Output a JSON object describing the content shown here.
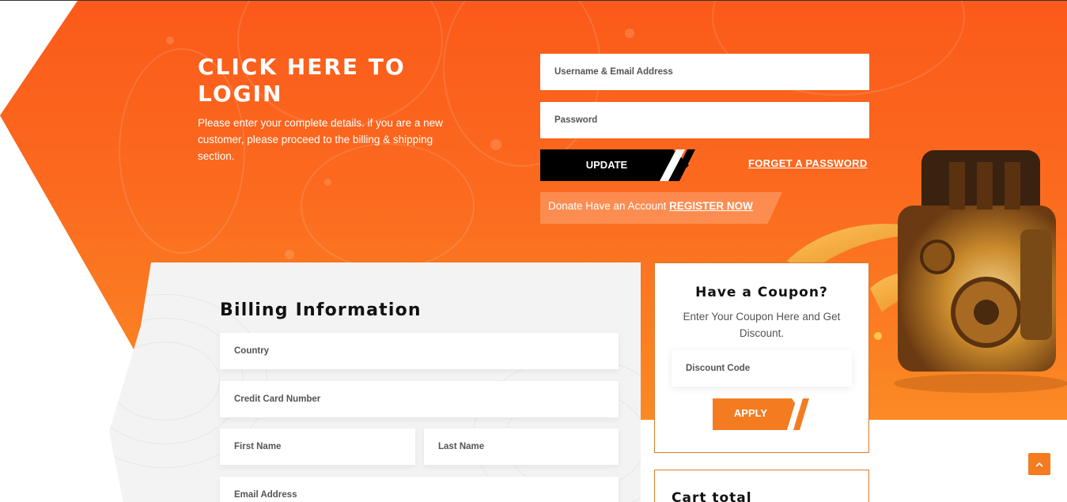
{
  "login": {
    "title": "CLICK HERE TO LOGIN",
    "description": "Please enter your complete details. if you are a new customer, please proceed to the billing & shipping section.",
    "username_placeholder": "Username & Email Address",
    "password_placeholder": "Password",
    "update_label": "UPDATE",
    "forget_label": "FORGET A PASSWORD",
    "register_prefix": "Donate Have an Account",
    "register_link": "REGISTER NOW"
  },
  "billing": {
    "title": "Billing Information",
    "country_placeholder": "Country",
    "card_placeholder": "Credit Card Number",
    "first_name_placeholder": "First Name",
    "last_name_placeholder": "Last Name",
    "email_placeholder": "Email Address"
  },
  "coupon": {
    "title": "Have a Coupon?",
    "description": "Enter Your Coupon Here and Get Discount.",
    "code_placeholder": "Discount Code",
    "apply_label": "APPLY"
  },
  "cart": {
    "title": "Cart total"
  },
  "colors": {
    "accent": "#f47c20",
    "hero_top": "#fb5a1a",
    "hero_bottom": "#fb8a24",
    "dark": "#000000"
  },
  "icons": {
    "scroll_top": "chevron-up-icon"
  }
}
